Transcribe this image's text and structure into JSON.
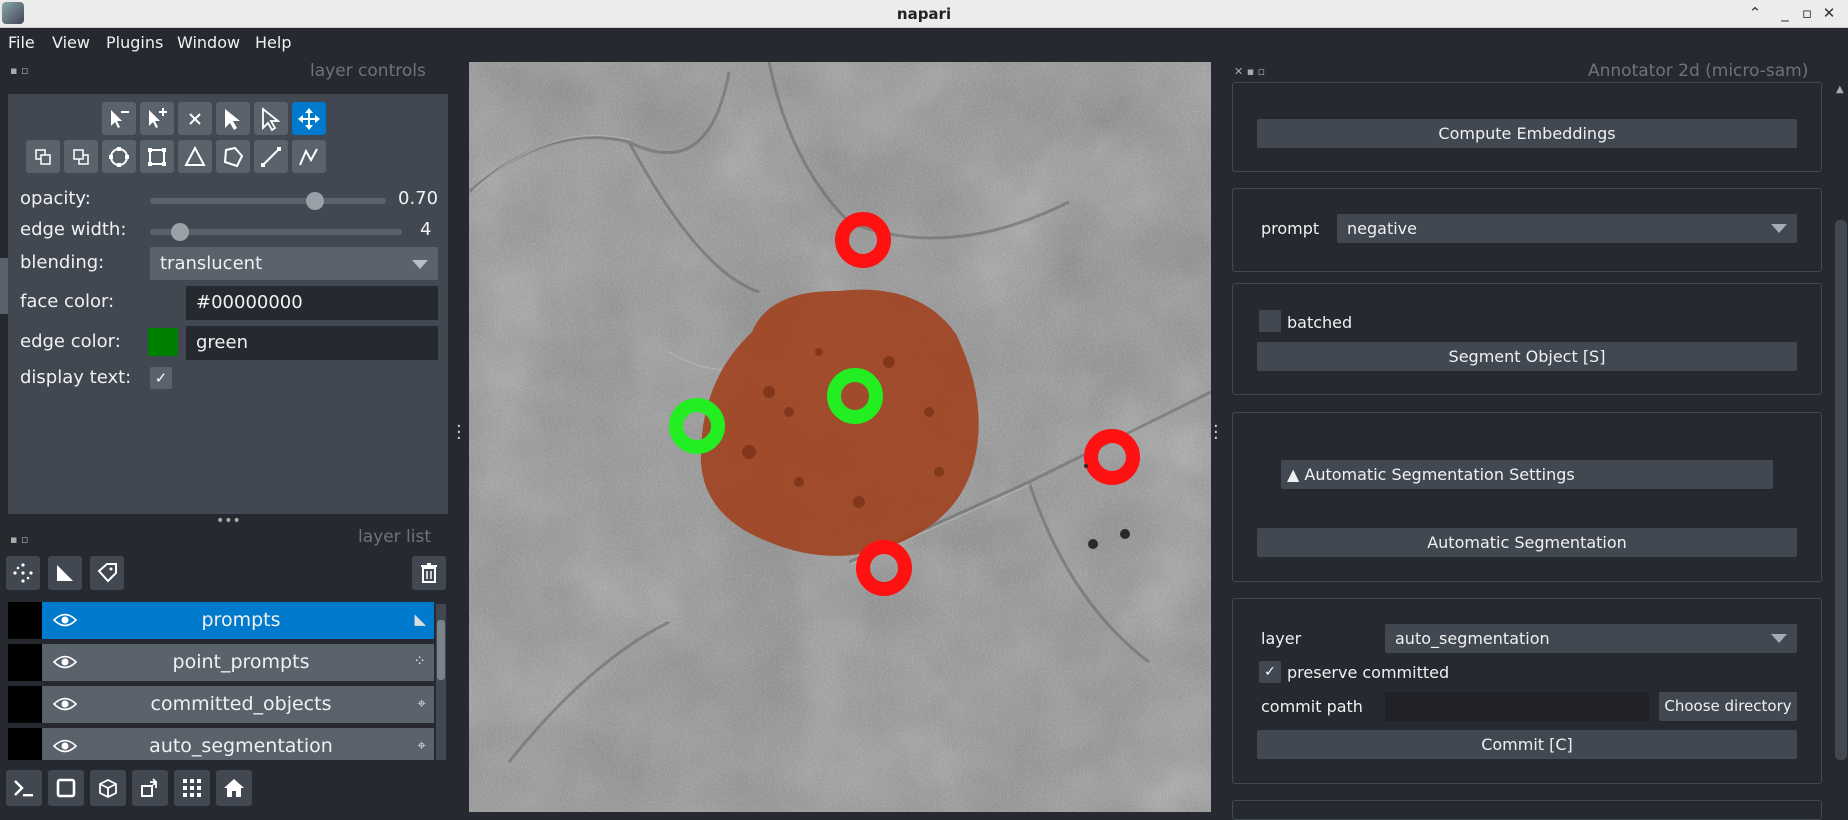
{
  "window": {
    "title": "napari"
  },
  "menubar": [
    "File",
    "View",
    "Plugins",
    "Window",
    "Help"
  ],
  "layer_controls": {
    "header": "layer controls",
    "opacity": {
      "label": "opacity:",
      "value": "0.70",
      "level": 0.7
    },
    "edge_width": {
      "label": "edge width:",
      "value": "4",
      "level": 0.12
    },
    "blending": {
      "label": "blending:",
      "value": "translucent"
    },
    "face_color": {
      "label": "face color:",
      "value": "#00000000"
    },
    "edge_color": {
      "label": "edge color:",
      "value": "green",
      "swatch": "#008000"
    },
    "display_text": {
      "label": "display text:",
      "checked": true,
      "check": "✓"
    }
  },
  "layer_list": {
    "header": "layer list",
    "layers": [
      {
        "name": "prompts",
        "selected": true,
        "type_icon": "shapes-icon"
      },
      {
        "name": "point_prompts",
        "selected": false,
        "type_icon": "points-icon"
      },
      {
        "name": "committed_objects",
        "selected": false,
        "type_icon": "labels-icon"
      },
      {
        "name": "auto_segmentation",
        "selected": false,
        "type_icon": "labels-icon"
      }
    ]
  },
  "annotator": {
    "header": "Annotator 2d (micro-sam)",
    "compute_embeddings": "Compute Embeddings",
    "prompt_label": "prompt",
    "prompt_value": "negative",
    "batched_label": "batched",
    "segment_object": "Segment Object [S]",
    "auto_seg_settings": "▲ Automatic Segmentation Settings",
    "automatic_segmentation": "Automatic Segmentation",
    "layer_label": "layer",
    "layer_value": "auto_segmentation",
    "preserve_label": "preserve committed",
    "preserve_check": "✓",
    "commit_path_label": "commit path",
    "choose_directory": "Choose directory",
    "commit": "Commit [C]"
  },
  "colors": {
    "accent": "#007acc",
    "positive_prompt": "#22ee22",
    "negative_prompt": "#ff1111",
    "mask": "#a0401c"
  },
  "window_buttons": {
    "up": "⌃",
    "minimize": "_",
    "maximize": "▫",
    "close": "✕"
  }
}
